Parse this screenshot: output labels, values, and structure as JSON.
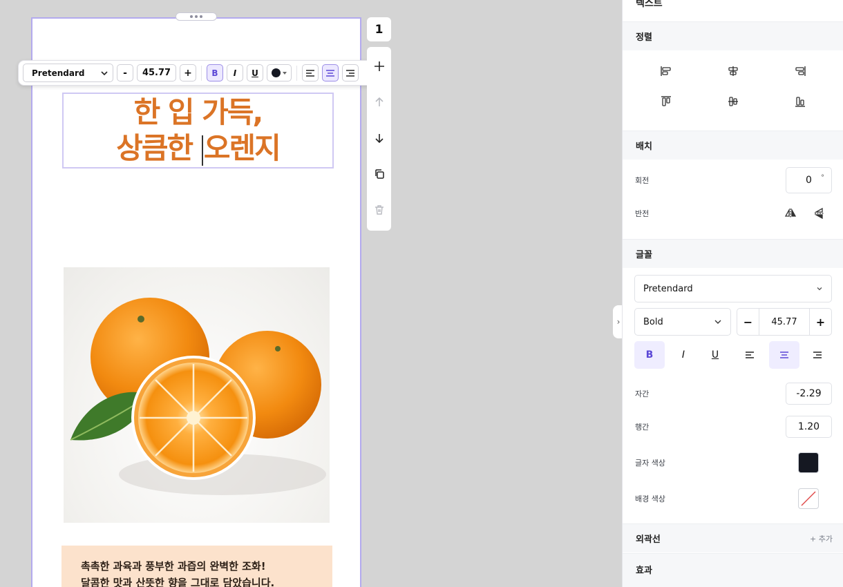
{
  "canvas": {
    "headline_line1": "한 입 가득,",
    "headline_line2_a": "상큼한 ",
    "headline_line2_b": "오렌지",
    "tagline_line1": "촉촉한 과육과 풍부한 과즙의 완벽한 조화!",
    "tagline_line2": "달콤한 맛과 산뜻한 향을 그대로 담았습니다.",
    "headline_color": "#db7426"
  },
  "toolbar": {
    "font": "Pretendard",
    "decrease_label": "-",
    "size": "45.77",
    "increase_label": "+",
    "bold_label": "B",
    "italic_label": "I",
    "underline_label": "U",
    "text_color": "#151822"
  },
  "page_number": "1",
  "panel": {
    "title": "텍스트",
    "align_section": "정렬",
    "layout_section": "배치",
    "rotation_label": "회전",
    "rotation_value": "0",
    "rotation_unit": "°",
    "flip_label": "반전",
    "font_section": "글꼴",
    "font_family": "Pretendard",
    "font_weight": "Bold",
    "font_size": "45.77",
    "minus_label": "−",
    "plus_label": "+",
    "bold_label": "B",
    "italic_label": "I",
    "underline_label": "U",
    "letter_spacing_label": "자간",
    "letter_spacing_value": "-2.29",
    "line_height_label": "행간",
    "line_height_value": "1.20",
    "text_color_label": "글자 색상",
    "text_color_value": "#151822",
    "bg_color_label": "배경 색상",
    "stroke_section": "외곽선",
    "stroke_add": "+ 추가",
    "effects_section": "효과"
  }
}
